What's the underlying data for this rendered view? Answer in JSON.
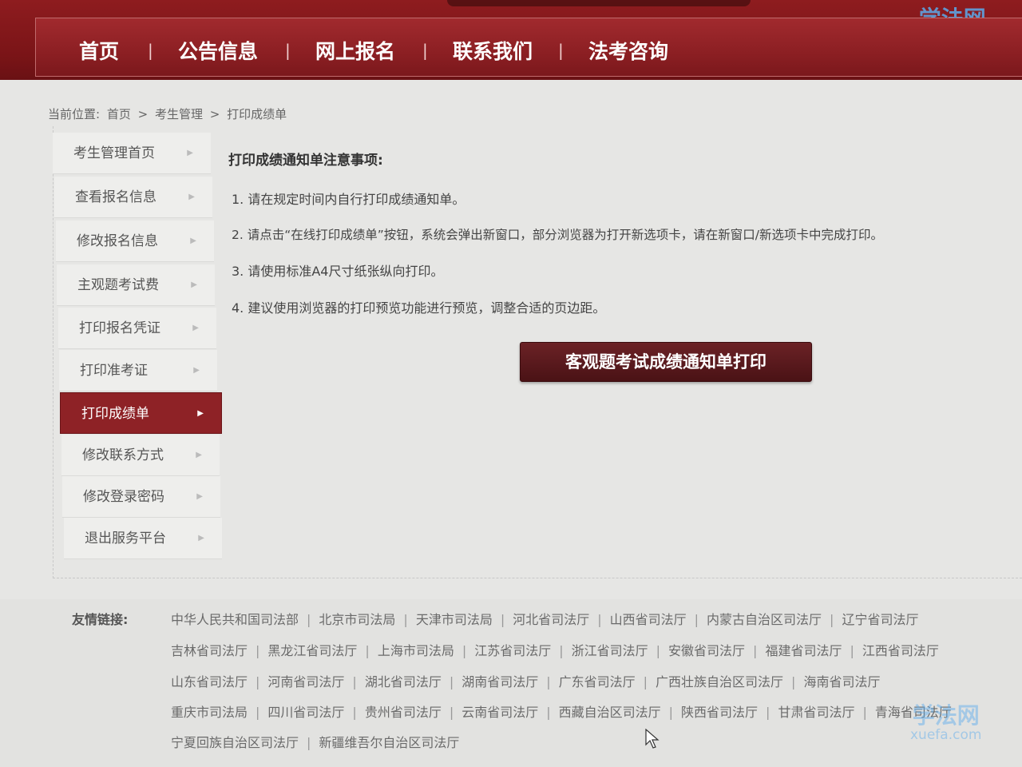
{
  "watermark": {
    "name": "学法网",
    "url": "xuefa.com"
  },
  "nav": {
    "items": [
      "首页",
      "公告信息",
      "网上报名",
      "联系我们",
      "法考咨询"
    ],
    "separator": "|"
  },
  "breadcrumb": {
    "prefix": "当前位置:",
    "items": [
      "首页",
      "考生管理",
      "打印成绩单"
    ],
    "separator": ">"
  },
  "sidebar": {
    "items": [
      {
        "label": "考生管理首页"
      },
      {
        "label": "查看报名信息"
      },
      {
        "label": "修改报名信息"
      },
      {
        "label": "主观题考试费"
      },
      {
        "label": "打印报名凭证"
      },
      {
        "label": "打印准考证"
      },
      {
        "label": "打印成绩单",
        "active": true
      },
      {
        "label": "修改联系方式"
      },
      {
        "label": "修改登录密码"
      },
      {
        "label": "退出服务平台"
      }
    ],
    "arrow": "▶"
  },
  "notice": {
    "title": "打印成绩通知单注意事项:",
    "items": [
      "1. 请在规定时间内自行打印成绩通知单。",
      "2. 请点击“在线打印成绩单”按钮，系统会弹出新窗口，部分浏览器为打开新选项卡，请在新窗口/新选项卡中完成打印。",
      "3. 请使用标准A4尺寸纸张纵向打印。",
      "4. 建议使用浏览器的打印预览功能进行预览，调整合适的页边距。"
    ]
  },
  "print_button": {
    "label": "客观题考试成绩通知单打印"
  },
  "links": {
    "label": "友情链接:",
    "rows": [
      [
        "中华人民共和国司法部",
        "北京市司法局",
        "天津市司法局",
        "河北省司法厅",
        "山西省司法厅",
        "内蒙古自治区司法厅",
        "辽宁省司法厅"
      ],
      [
        "吉林省司法厅",
        "黑龙江省司法厅",
        "上海市司法局",
        "江苏省司法厅",
        "浙江省司法厅",
        "安徽省司法厅",
        "福建省司法厅",
        "江西省司法厅"
      ],
      [
        "山东省司法厅",
        "河南省司法厅",
        "湖北省司法厅",
        "湖南省司法厅",
        "广东省司法厅",
        "广西壮族自治区司法厅",
        "海南省司法厅"
      ],
      [
        "重庆市司法局",
        "四川省司法厅",
        "贵州省司法厅",
        "云南省司法厅",
        "西藏自治区司法厅",
        "陕西省司法厅",
        "甘肃省司法厅",
        "青海省司法厅"
      ],
      [
        "宁夏回族自治区司法厅",
        "新疆维吾尔自治区司法厅"
      ]
    ]
  },
  "colors": {
    "brand_red": "#8e2226",
    "button_dark": "#4a1215"
  }
}
